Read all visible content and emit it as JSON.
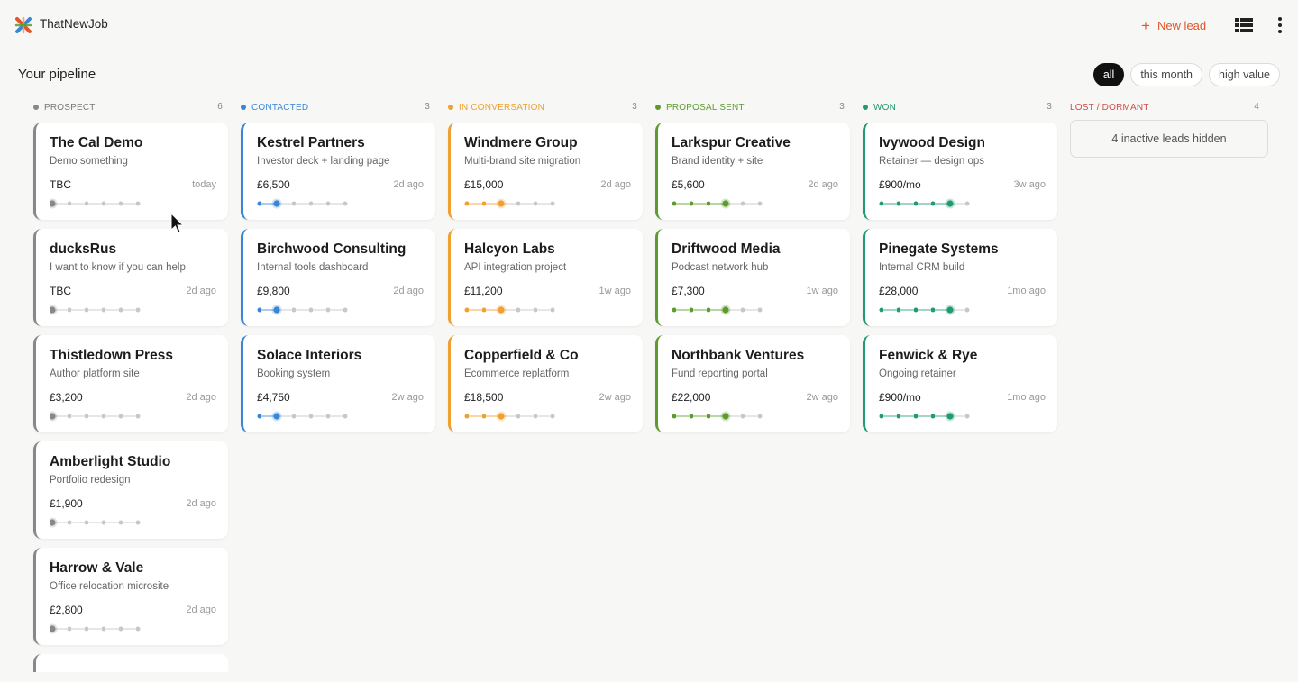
{
  "app": {
    "name": "ThatNewJob"
  },
  "topbar": {
    "new_lead_label": "New lead"
  },
  "page": {
    "title": "Your pipeline"
  },
  "filters": [
    {
      "label": "all",
      "active": true
    },
    {
      "label": "this month",
      "active": false
    },
    {
      "label": "high value",
      "active": false
    }
  ],
  "columns": [
    {
      "label": "PROSPECT",
      "count": "6",
      "color": "#888888",
      "stage": 1,
      "cards": [
        {
          "title": "The Cal Demo",
          "subtitle": "Demo something",
          "value": "TBC",
          "age": "today"
        },
        {
          "title": "ducksRus",
          "subtitle": "I want to know if you can help",
          "value": "TBC",
          "age": "2d ago"
        },
        {
          "title": "Thistledown Press",
          "subtitle": "Author platform site",
          "value": "£3,200",
          "age": "2d ago"
        },
        {
          "title": "Amberlight Studio",
          "subtitle": "Portfolio redesign",
          "value": "£1,900",
          "age": "2d ago"
        },
        {
          "title": "Harrow & Vale",
          "subtitle": "Office relocation microsite",
          "value": "£2,800",
          "age": "2d ago"
        }
      ]
    },
    {
      "label": "CONTACTED",
      "count": "3",
      "color": "#3a86d6",
      "stage": 2,
      "cards": [
        {
          "title": "Kestrel Partners",
          "subtitle": "Investor deck + landing page",
          "value": "£6,500",
          "age": "2d ago"
        },
        {
          "title": "Birchwood Consulting",
          "subtitle": "Internal tools dashboard",
          "value": "£9,800",
          "age": "2d ago"
        },
        {
          "title": "Solace Interiors",
          "subtitle": "Booking system",
          "value": "£4,750",
          "age": "2w ago"
        }
      ]
    },
    {
      "label": "IN CONVERSATION",
      "count": "3",
      "color": "#eea031",
      "stage": 3,
      "cards": [
        {
          "title": "Windmere Group",
          "subtitle": "Multi-brand site migration",
          "value": "£15,000",
          "age": "2d ago"
        },
        {
          "title": "Halcyon Labs",
          "subtitle": "API integration project",
          "value": "£11,200",
          "age": "1w ago"
        },
        {
          "title": "Copperfield & Co",
          "subtitle": "Ecommerce replatform",
          "value": "£18,500",
          "age": "2w ago"
        }
      ]
    },
    {
      "label": "PROPOSAL SENT",
      "count": "3",
      "color": "#5e9b2e",
      "stage": 4,
      "cards": [
        {
          "title": "Larkspur Creative",
          "subtitle": "Brand identity + site",
          "value": "£5,600",
          "age": "2d ago"
        },
        {
          "title": "Driftwood Media",
          "subtitle": "Podcast network hub",
          "value": "£7,300",
          "age": "1w ago"
        },
        {
          "title": "Northbank Ventures",
          "subtitle": "Fund reporting portal",
          "value": "£22,000",
          "age": "2w ago"
        }
      ]
    },
    {
      "label": "WON",
      "count": "3",
      "color": "#1f9a72",
      "stage": 5,
      "cards": [
        {
          "title": "Ivywood Design",
          "subtitle": "Retainer — design ops",
          "value": "£900/mo",
          "age": "3w ago"
        },
        {
          "title": "Pinegate Systems",
          "subtitle": "Internal CRM build",
          "value": "£28,000",
          "age": "1mo ago"
        },
        {
          "title": "Fenwick & Rye",
          "subtitle": "Ongoing retainer",
          "value": "£900/mo",
          "age": "1mo ago"
        }
      ]
    },
    {
      "label": "LOST / DORMANT",
      "count": "4",
      "color": "#d04b4b",
      "hidden_note": "4 inactive leads hidden"
    }
  ],
  "stage_count": 6,
  "colors": {
    "accent": "#e0552b",
    "inactive_dot": "#c8c8c8"
  }
}
